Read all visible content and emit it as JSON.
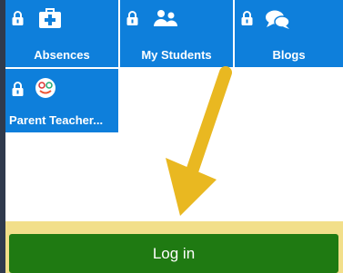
{
  "tiles": [
    {
      "label": "Absences",
      "icon": "first-aid-kit-icon"
    },
    {
      "label": "My Students",
      "icon": "students-icon"
    },
    {
      "label": "Blogs",
      "icon": "chat-bubbles-icon"
    },
    {
      "label": "Parent Teacher...",
      "icon": "ptc-face-icon"
    }
  ],
  "login": {
    "label": "Log in"
  },
  "colors": {
    "tile": "#0e7fdb",
    "login_button": "#1f7a12",
    "band": "#f2df8a",
    "arrow": "#e9b821"
  }
}
